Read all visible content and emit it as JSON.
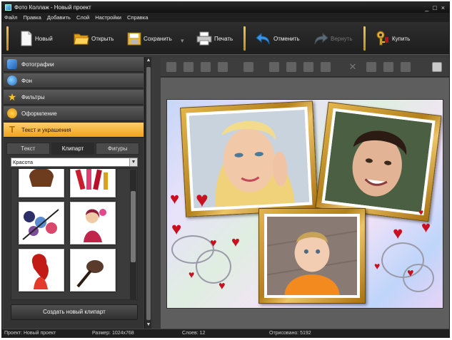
{
  "window": {
    "title": "Фото Коллаж - Новый проект",
    "controls": [
      "_",
      "□",
      "×"
    ]
  },
  "menu": [
    "Файл",
    "Правка",
    "Добавить",
    "Слой",
    "Настройки",
    "Справка"
  ],
  "toolbar": {
    "new_label": "Новый",
    "open_label": "Открыть",
    "save_label": "Сохранить",
    "print_label": "Печать",
    "undo_label": "Отменить",
    "redo_label": "Вернуть",
    "buy_label": "Купить"
  },
  "sidebar": {
    "categories": [
      {
        "label": "Фотографии",
        "icon": "photo-icon"
      },
      {
        "label": "Фон",
        "icon": "globe-icon"
      },
      {
        "label": "Фильтры",
        "icon": "star-icon"
      },
      {
        "label": "Оформление",
        "icon": "palette-icon"
      },
      {
        "label": "Текст и украшения",
        "icon": "text-decor-icon"
      }
    ],
    "tabs": [
      "Текст",
      "Клипарт",
      "Фигуры"
    ],
    "active_tab": "Клипарт",
    "select_value": "Красота",
    "create_button": "Создать новый клипарт"
  },
  "status": {
    "project": "Проект: Новый проект",
    "size": "Размер: 1024x768",
    "layers": "Слоев: 12",
    "rendered": "Отрисовано: 5192"
  },
  "colors": {
    "accent": "#f0a21c",
    "frame_gold": "#d4a23a",
    "heart_red": "#c8101f",
    "toolbar_sep": "#f3c34a"
  }
}
